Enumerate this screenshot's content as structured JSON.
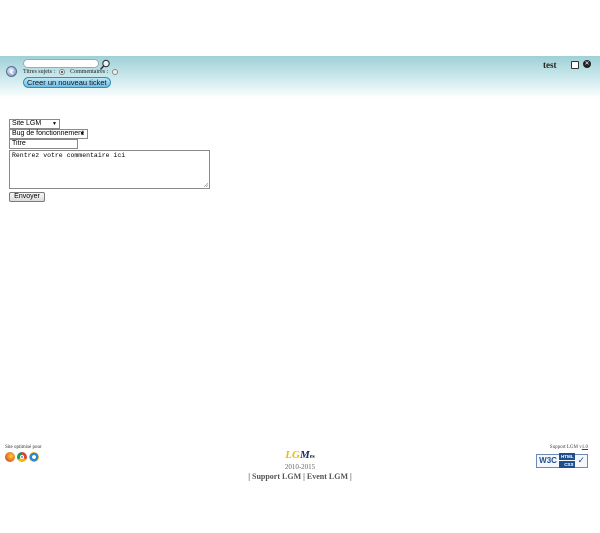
{
  "header": {
    "search": {
      "value": "",
      "placeholder": ""
    },
    "filters": {
      "topic_titles_label": "Titres sujets :",
      "comments_label": "Commentaires :",
      "selected": "topic_titles"
    },
    "new_ticket_label": "Creer un nouveau ticket",
    "username": "test"
  },
  "form": {
    "site_select": {
      "value": "Site LGM"
    },
    "type_select": {
      "value": "Bug de fonctionnement"
    },
    "title_input": {
      "value": "Titre"
    },
    "comment": {
      "value": "Rentrez votre commentaire ici"
    },
    "submit_label": "Envoyer"
  },
  "footer": {
    "optimized_for": "Site optimisé pour",
    "browsers": [
      "firefox-icon",
      "chrome-icon",
      "ie-icon"
    ],
    "logo": {
      "part1": "L",
      "part2": "G",
      "part3": "M",
      "part4": "es"
    },
    "years": "2010-2015",
    "links": {
      "sep1": "|",
      "support": "Support LGM",
      "sep2": "|",
      "event": "Event LGM",
      "sep3": "|"
    },
    "version_prefix": "Support LGM v",
    "version": "1.0",
    "w3c": {
      "label": "W3C",
      "html": "HTML",
      "css": "CSS"
    }
  },
  "colors": {
    "header_gradient_top": "#9fd0d6",
    "button_blue": "#6dbfe3"
  }
}
